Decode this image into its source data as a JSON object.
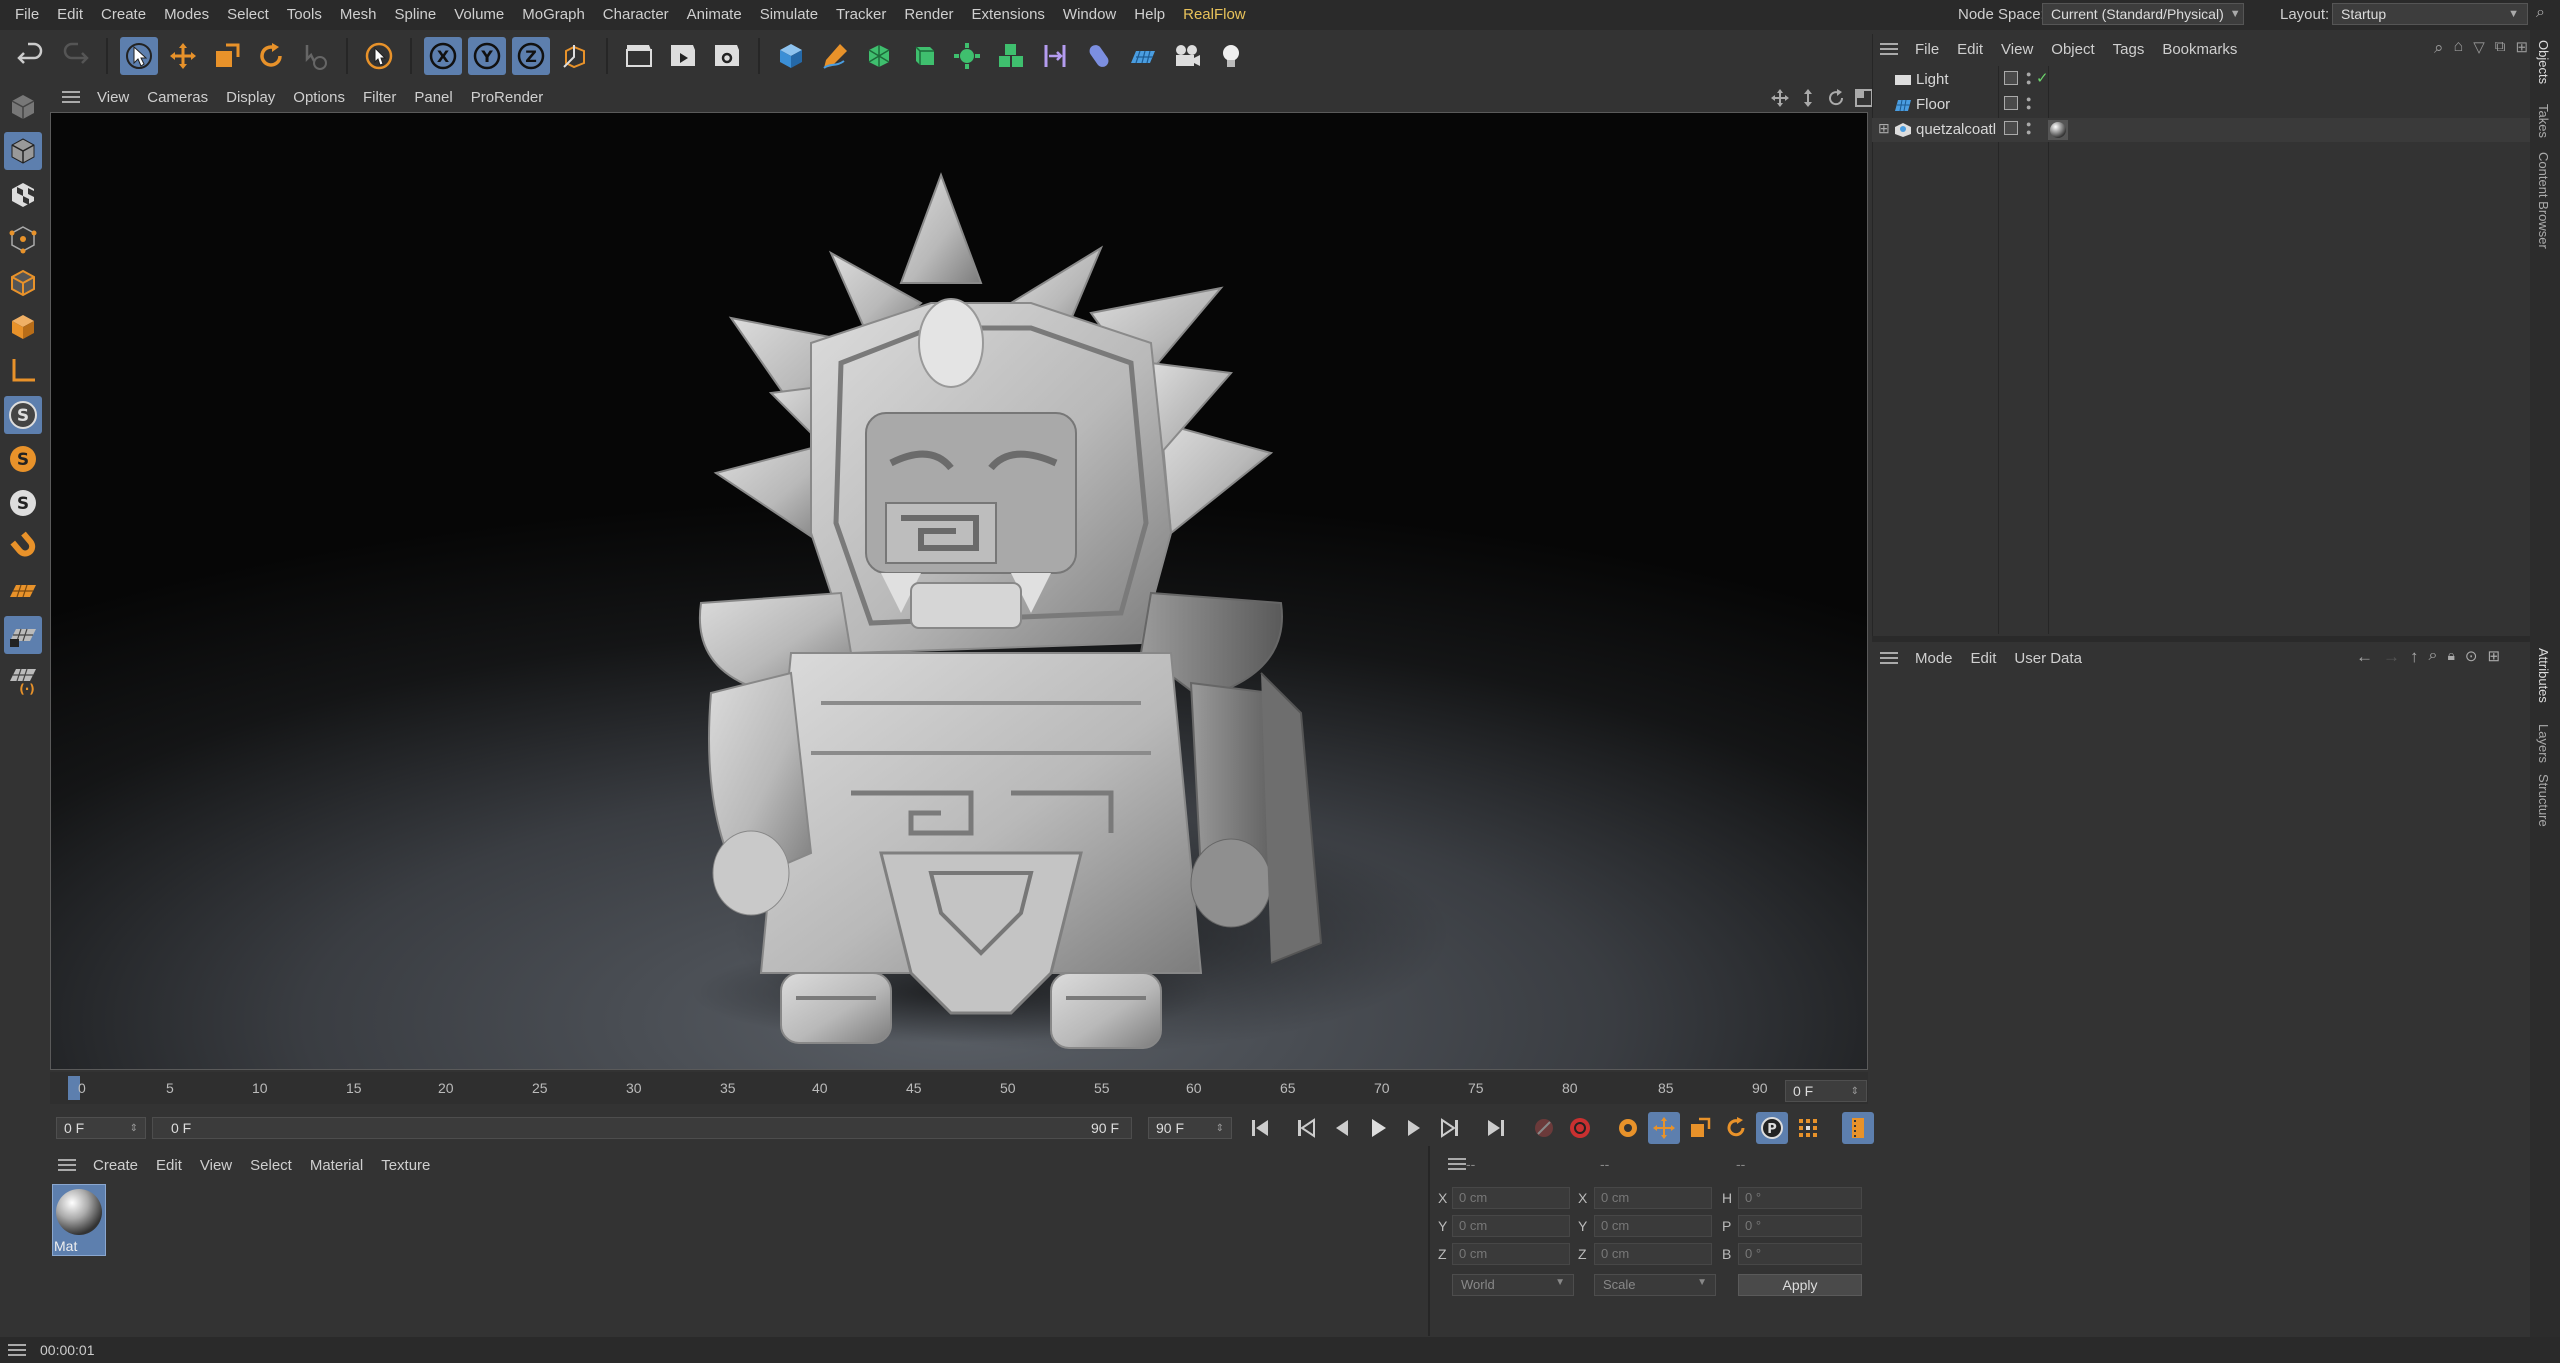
{
  "menubar": {
    "items": [
      "File",
      "Edit",
      "Create",
      "Modes",
      "Select",
      "Tools",
      "Mesh",
      "Spline",
      "Volume",
      "MoGraph",
      "Character",
      "Animate",
      "Simulate",
      "Tracker",
      "Render",
      "Extensions",
      "Window",
      "Help",
      "RealFlow"
    ],
    "node_space_label": "Node Space:",
    "node_space_value": "Current (Standard/Physical)",
    "layout_label": "Layout:",
    "layout_value": "Startup"
  },
  "viewport": {
    "menu": [
      "View",
      "Cameras",
      "Display",
      "Options",
      "Filter",
      "Panel",
      "ProRender"
    ]
  },
  "timeline": {
    "ticks": [
      "0",
      "5",
      "10",
      "15",
      "20",
      "25",
      "30",
      "35",
      "40",
      "45",
      "50",
      "55",
      "60",
      "65",
      "70",
      "75",
      "80",
      "85",
      "90"
    ],
    "current_frame": "0 F",
    "start": "0 F",
    "range_start": "0 F",
    "range_end": "90 F",
    "end": "90 F"
  },
  "material_manager": {
    "menu": [
      "Create",
      "Edit",
      "View",
      "Select",
      "Material",
      "Texture"
    ],
    "material_name": "Mat"
  },
  "coordinates": {
    "headers": [
      "--",
      "--",
      "--"
    ],
    "rows": [
      {
        "l1": "X",
        "v1": "0 cm",
        "l2": "X",
        "v2": "0 cm",
        "l3": "H",
        "v3": "0 °"
      },
      {
        "l1": "Y",
        "v1": "0 cm",
        "l2": "Y",
        "v2": "0 cm",
        "l3": "P",
        "v3": "0 °"
      },
      {
        "l1": "Z",
        "v1": "0 cm",
        "l2": "Z",
        "v2": "0 cm",
        "l3": "B",
        "v3": "0 °"
      }
    ],
    "space": "World",
    "mode": "Scale",
    "apply": "Apply"
  },
  "object_manager": {
    "menu": [
      "File",
      "Edit",
      "View",
      "Object",
      "Tags",
      "Bookmarks"
    ],
    "objects": [
      "Light",
      "Floor",
      "quetzalcoatl"
    ]
  },
  "attributes": {
    "menu": [
      "Mode",
      "Edit",
      "User Data"
    ]
  },
  "side_tabs": [
    "Objects",
    "Takes",
    "Content Browser",
    "Attributes",
    "Layers",
    "Structure"
  ],
  "status": {
    "time": "00:00:01"
  },
  "colors": {
    "accent": "#5d7fae",
    "orange": "#e8922a",
    "realflow": "#e8c25a"
  }
}
